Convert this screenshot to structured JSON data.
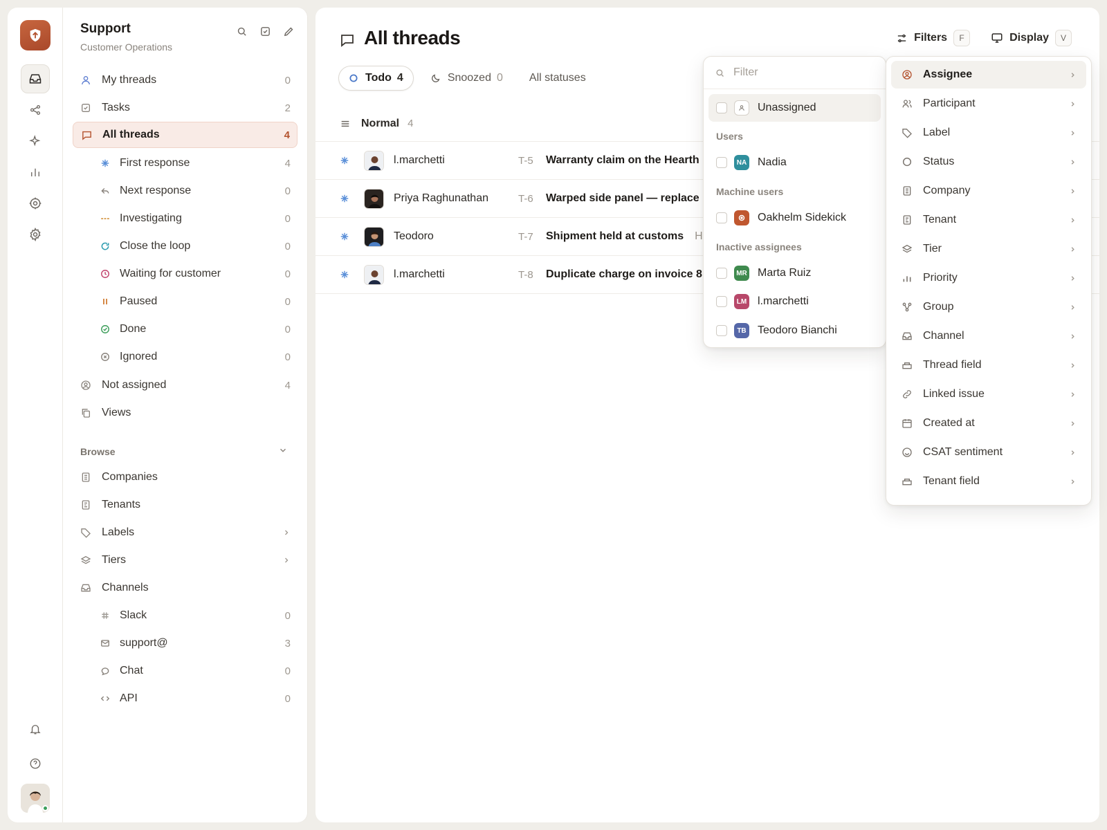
{
  "sidebar": {
    "title": "Support",
    "subtitle": "Customer Operations",
    "items": [
      {
        "label": "My threads",
        "count": "0"
      },
      {
        "label": "Tasks",
        "count": "2"
      },
      {
        "label": "All threads",
        "count": "4"
      },
      {
        "label": "First response",
        "count": "4"
      },
      {
        "label": "Next response",
        "count": "0"
      },
      {
        "label": "Investigating",
        "count": "0"
      },
      {
        "label": "Close the loop",
        "count": "0"
      },
      {
        "label": "Waiting for customer",
        "count": "0"
      },
      {
        "label": "Paused",
        "count": "0"
      },
      {
        "label": "Done",
        "count": "0"
      },
      {
        "label": "Ignored",
        "count": "0"
      },
      {
        "label": "Not assigned",
        "count": "4"
      },
      {
        "label": "Views",
        "count": ""
      }
    ],
    "browse_label": "Browse",
    "browse": [
      {
        "label": "Companies",
        "count": ""
      },
      {
        "label": "Tenants",
        "count": ""
      },
      {
        "label": "Labels",
        "count": ""
      },
      {
        "label": "Tiers",
        "count": ""
      },
      {
        "label": "Channels",
        "count": ""
      },
      {
        "label": "Slack",
        "count": "0"
      },
      {
        "label": "support@",
        "count": "3"
      },
      {
        "label": "Chat",
        "count": "0"
      },
      {
        "label": "API",
        "count": "0"
      }
    ]
  },
  "main": {
    "title": "All threads",
    "filters_label": "Filters",
    "filters_key": "F",
    "display_label": "Display",
    "display_key": "V",
    "tabs": [
      {
        "label": "Todo",
        "count": "4"
      },
      {
        "label": "Snoozed",
        "count": "0"
      },
      {
        "label": "All statuses",
        "count": ""
      }
    ],
    "group": {
      "label": "Normal",
      "count": "4"
    },
    "rows": [
      {
        "name": "l.marchetti",
        "id": "T-5",
        "title": "Warranty claim on the Hearth",
        "extra": ""
      },
      {
        "name": "Priya Raghunathan",
        "id": "T-6",
        "title": "Warped side panel — replace",
        "extra": ""
      },
      {
        "name": "Teodoro",
        "id": "T-7",
        "title": "Shipment held at customs",
        "extra": "H"
      },
      {
        "name": "l.marchetti",
        "id": "T-8",
        "title": "Duplicate charge on invoice 8",
        "extra": ""
      }
    ]
  },
  "assignee_popover": {
    "placeholder": "Filter",
    "unassigned": "Unassigned",
    "users_heading": "Users",
    "users": [
      {
        "initials": "NA",
        "name": "Nadia",
        "color": "#2f8f9d"
      }
    ],
    "machine_heading": "Machine users",
    "machine": [
      {
        "name": "Oakhelm Sidekick",
        "color": "#c0572f"
      }
    ],
    "inactive_heading": "Inactive assignees",
    "inactive": [
      {
        "initials": "MR",
        "name": "Marta Ruiz",
        "color": "#3f8a4e"
      },
      {
        "initials": "LM",
        "name": "l.marchetti",
        "color": "#b8486a"
      },
      {
        "initials": "TB",
        "name": "Teodoro Bianchi",
        "color": "#5567a8"
      }
    ]
  },
  "filter_menu": [
    {
      "label": "Assignee",
      "icon": "user-circle-icon"
    },
    {
      "label": "Participant",
      "icon": "users-icon"
    },
    {
      "label": "Label",
      "icon": "tag-icon"
    },
    {
      "label": "Status",
      "icon": "circle-icon"
    },
    {
      "label": "Company",
      "icon": "building-icon"
    },
    {
      "label": "Tenant",
      "icon": "building-icon"
    },
    {
      "label": "Tier",
      "icon": "layers-icon"
    },
    {
      "label": "Priority",
      "icon": "bars-icon"
    },
    {
      "label": "Group",
      "icon": "group-icon"
    },
    {
      "label": "Channel",
      "icon": "inbox-icon"
    },
    {
      "label": "Thread field",
      "icon": "field-icon"
    },
    {
      "label": "Linked issue",
      "icon": "link-icon"
    },
    {
      "label": "Created at",
      "icon": "calendar-icon"
    },
    {
      "label": "CSAT sentiment",
      "icon": "smile-icon"
    },
    {
      "label": "Tenant field",
      "icon": "field-icon"
    }
  ],
  "colors": {
    "accent": "#b4532f",
    "status_blue": "#5a8fd8"
  }
}
